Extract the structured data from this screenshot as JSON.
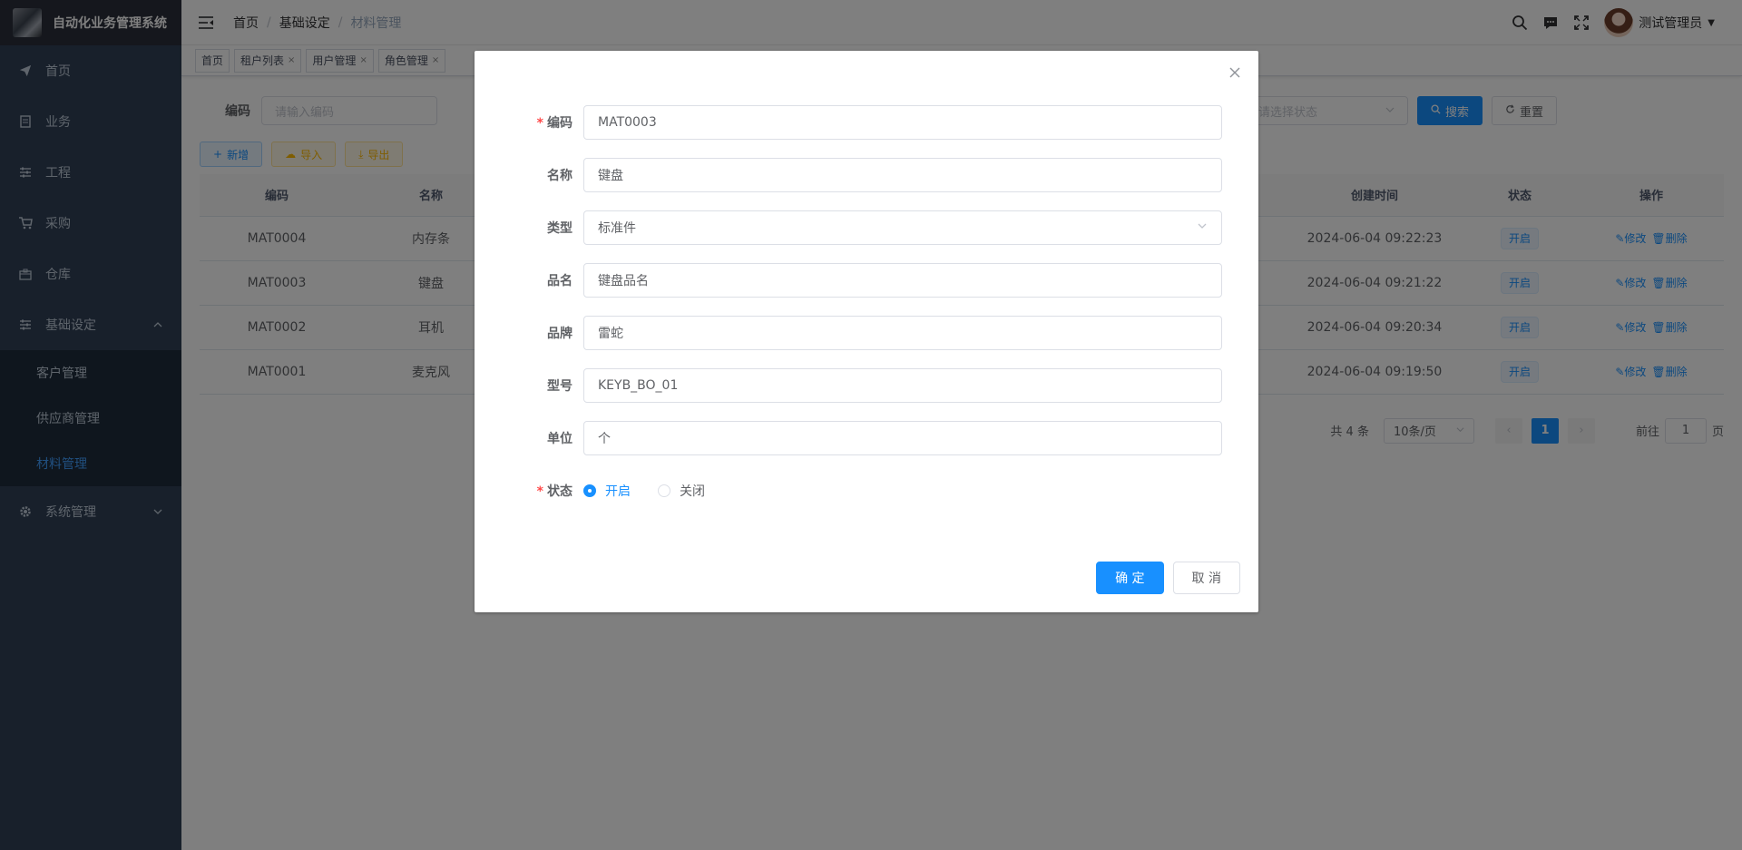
{
  "app": {
    "title": "自动化业务管理系统"
  },
  "sidebar": {
    "items": [
      {
        "label": "首页",
        "icon": "send-icon"
      },
      {
        "label": "业务",
        "icon": "document-icon"
      },
      {
        "label": "工程",
        "icon": "sliders-icon"
      },
      {
        "label": "采购",
        "icon": "cart-icon"
      },
      {
        "label": "仓库",
        "icon": "warehouse-icon"
      },
      {
        "label": "基础设定",
        "icon": "sliders-icon"
      },
      {
        "label": "系统管理",
        "icon": "gear-icon"
      }
    ],
    "submenu": [
      {
        "label": "客户管理"
      },
      {
        "label": "供应商管理"
      },
      {
        "label": "材料管理"
      }
    ]
  },
  "navbar": {
    "breadcrumb": [
      "首页",
      "基础设定",
      "材料管理"
    ],
    "username": "测试管理员"
  },
  "tags": [
    "首页",
    "租户列表",
    "用户管理",
    "角色管理"
  ],
  "search": {
    "code_label": "编码",
    "code_placeholder": "请输入编码",
    "status_placeholder": "请选择状态",
    "search_label": "搜索",
    "reset_label": "重置"
  },
  "toolbar": {
    "add": "新增",
    "import": "导入",
    "export": "导出"
  },
  "table": {
    "headers": [
      "编码",
      "名称",
      "创建时间",
      "状态",
      "操作"
    ],
    "rows": [
      {
        "code": "MAT0004",
        "name": "内存条",
        "created": "2024-06-04 09:22:23",
        "status": "开启"
      },
      {
        "code": "MAT0003",
        "name": "键盘",
        "created": "2024-06-04 09:21:22",
        "status": "开启"
      },
      {
        "code": "MAT0002",
        "name": "耳机",
        "created": "2024-06-04 09:20:34",
        "status": "开启"
      },
      {
        "code": "MAT0001",
        "name": "麦克风",
        "created": "2024-06-04 09:19:50",
        "status": "开启"
      }
    ],
    "edit": "修改",
    "delete": "删除"
  },
  "pagination": {
    "total": "共 4 条",
    "page_size": "10条/页",
    "current": "1",
    "goto_prefix": "前往",
    "goto_value": "1",
    "goto_suffix": "页"
  },
  "dialog": {
    "fields": [
      {
        "label": "编码",
        "value": "MAT0003",
        "required": true
      },
      {
        "label": "名称",
        "value": "键盘",
        "required": false
      },
      {
        "label": "类型",
        "value": "标准件",
        "required": false
      },
      {
        "label": "品名",
        "value": "键盘品名",
        "required": false
      },
      {
        "label": "品牌",
        "value": "雷蛇",
        "required": false
      },
      {
        "label": "型号",
        "value": "KEYB_BO_01",
        "required": false
      },
      {
        "label": "单位",
        "value": "个",
        "required": false
      }
    ],
    "status_label": "状态",
    "status_options": [
      "开启",
      "关闭"
    ],
    "status_selected": "开启",
    "confirm": "确 定",
    "cancel": "取 消"
  },
  "colors": {
    "primary": "#1890ff",
    "sidebar": "#304156",
    "active_menu": "#409eff"
  }
}
